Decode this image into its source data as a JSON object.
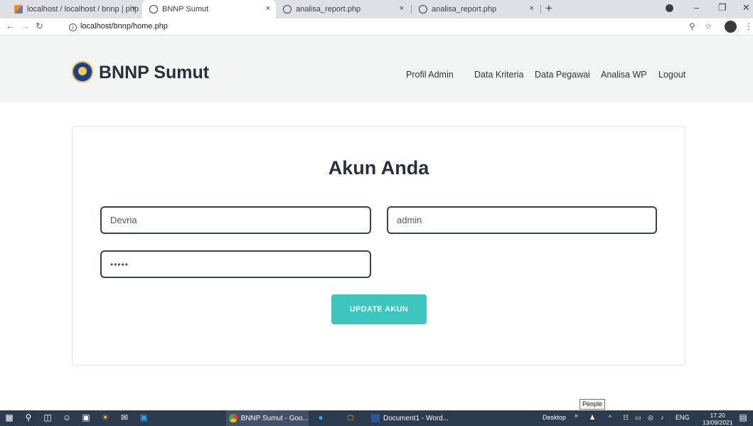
{
  "browser": {
    "tabs": [
      {
        "label": "localhost / localhost / bnnp | php",
        "active": false
      },
      {
        "label": "BNNP Sumut",
        "active": true
      },
      {
        "label": "analisa_report.php",
        "active": false
      },
      {
        "label": "analisa_report.php",
        "active": false
      }
    ],
    "close_glyph": "×",
    "new_tab_glyph": "+",
    "url": "localhost/bnnp/home.php"
  },
  "site": {
    "brand": "BNNP Sumut",
    "menu": [
      "Profil Admin",
      "Data Kriteria",
      "Data Pegawai",
      "Analisa WP",
      "Logout"
    ]
  },
  "account": {
    "title": "Akun Anda",
    "name_value": "Devria",
    "username_value": "admin",
    "password_value": "•••••",
    "update_button": "UPDATE AKUN"
  },
  "tooltip": "People",
  "taskbar": {
    "apps": [
      {
        "label": "BNNP Sumut - Goo...",
        "active": true
      },
      {
        "label": "Document1 - Word...",
        "active": false
      }
    ],
    "desktop_label": "Desktop",
    "language": "ENG",
    "time": "17.20",
    "date": "13/09/2021"
  },
  "colors": {
    "accent_button": "#3cc6bd",
    "navbar_bg": "#f3f4f4",
    "taskbar_bg": "#2b3a4d"
  }
}
